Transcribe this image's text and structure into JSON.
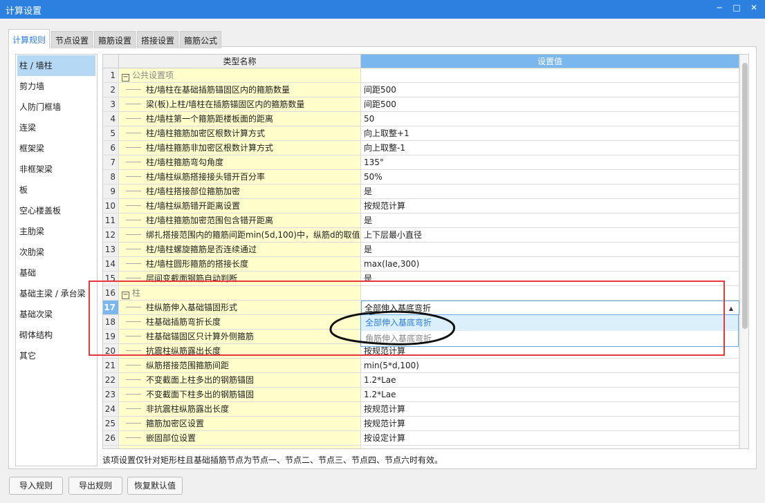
{
  "window": {
    "title": "计算设置",
    "minimize": "−",
    "maximize": "□",
    "close": "✕"
  },
  "tabs": [
    "计算规则",
    "节点设置",
    "箍筋设置",
    "搭接设置",
    "箍筋公式"
  ],
  "sidebar": [
    "柱 / 墙柱",
    "剪力墙",
    "人防门框墙",
    "连梁",
    "框架梁",
    "非框架梁",
    "板",
    "空心楼盖板",
    "主肋梁",
    "次肋梁",
    "基础",
    "基础主梁 / 承台梁",
    "基础次梁",
    "砌体结构",
    "其它"
  ],
  "grid": {
    "headers": {
      "name": "类型名称",
      "value": "设置值"
    },
    "rows": [
      {
        "n": "1",
        "name": "公共设置项",
        "value": "",
        "group": true
      },
      {
        "n": "2",
        "name": "柱/墙柱在基础插筋锚固区内的箍筋数量",
        "value": "间距500"
      },
      {
        "n": "3",
        "name": "梁(板)上柱/墙柱在插筋锚固区内的箍筋数量",
        "value": "间距500"
      },
      {
        "n": "4",
        "name": "柱/墙柱第一个箍筋距楼板面的距离",
        "value": "50"
      },
      {
        "n": "5",
        "name": "柱/墙柱箍筋加密区根数计算方式",
        "value": "向上取整+1"
      },
      {
        "n": "6",
        "name": "柱/墙柱箍筋非加密区根数计算方式",
        "value": "向上取整-1"
      },
      {
        "n": "7",
        "name": "柱/墙柱箍筋弯勾角度",
        "value": "135°"
      },
      {
        "n": "8",
        "name": "柱/墙柱纵筋搭接接头错开百分率",
        "value": "50%"
      },
      {
        "n": "9",
        "name": "柱/墙柱搭接部位箍筋加密",
        "value": "是"
      },
      {
        "n": "10",
        "name": "柱/墙柱纵筋错开距离设置",
        "value": "按规范计算"
      },
      {
        "n": "11",
        "name": "柱/墙柱箍筋加密范围包含错开距离",
        "value": "是"
      },
      {
        "n": "12",
        "name": "绑扎搭接范围内的箍筋间距min(5d,100)中，纵筋d的取值",
        "value": "上下层最小直径"
      },
      {
        "n": "13",
        "name": "柱/墙柱螺旋箍筋是否连续通过",
        "value": "是"
      },
      {
        "n": "14",
        "name": "柱/墙柱圆形箍筋的搭接长度",
        "value": "max(lae,300)"
      },
      {
        "n": "15",
        "name": "层间变截面钢筋自动判断",
        "value": "是"
      },
      {
        "n": "16",
        "name": "柱",
        "value": "",
        "group": true
      },
      {
        "n": "17",
        "name": "柱纵筋伸入基础锚固形式",
        "value": "全部伸入基底弯折",
        "current": true
      },
      {
        "n": "18",
        "name": "柱基础插筋弯折长度",
        "value": ""
      },
      {
        "n": "19",
        "name": "柱基础锚固区只计算外侧箍筋",
        "value": ""
      },
      {
        "n": "20",
        "name": "抗震柱纵筋露出长度",
        "value": "按规范计算"
      },
      {
        "n": "21",
        "name": "纵筋搭接范围箍筋间距",
        "value": "min(5*d,100)"
      },
      {
        "n": "22",
        "name": "不变截面上柱多出的钢筋锚固",
        "value": "1.2*Lae"
      },
      {
        "n": "23",
        "name": "不变截面下柱多出的钢筋锚固",
        "value": "1.2*Lae"
      },
      {
        "n": "24",
        "name": "非抗震柱纵筋露出长度",
        "value": "按规范计算"
      },
      {
        "n": "25",
        "name": "箍筋加密区设置",
        "value": "按规范计算"
      },
      {
        "n": "26",
        "name": "嵌固部位设置",
        "value": "按设定计算"
      }
    ]
  },
  "dropdown": {
    "options": [
      "全部伸入基底弯折",
      "角筋伸入基底弯折"
    ],
    "highlighted": 0
  },
  "description": "该项设置仅针对矩形柱且基础插筋节点为节点一、节点二、节点三、节点四、节点六时有效。",
  "buttons": {
    "import": "导入规则",
    "export": "导出规则",
    "restore": "恢复默认值"
  },
  "colors": {
    "titlebar": "#2b80e0",
    "annotation_box": "#e8353a",
    "name_column": "#ffffcc",
    "selected": "#b5d9f5"
  }
}
